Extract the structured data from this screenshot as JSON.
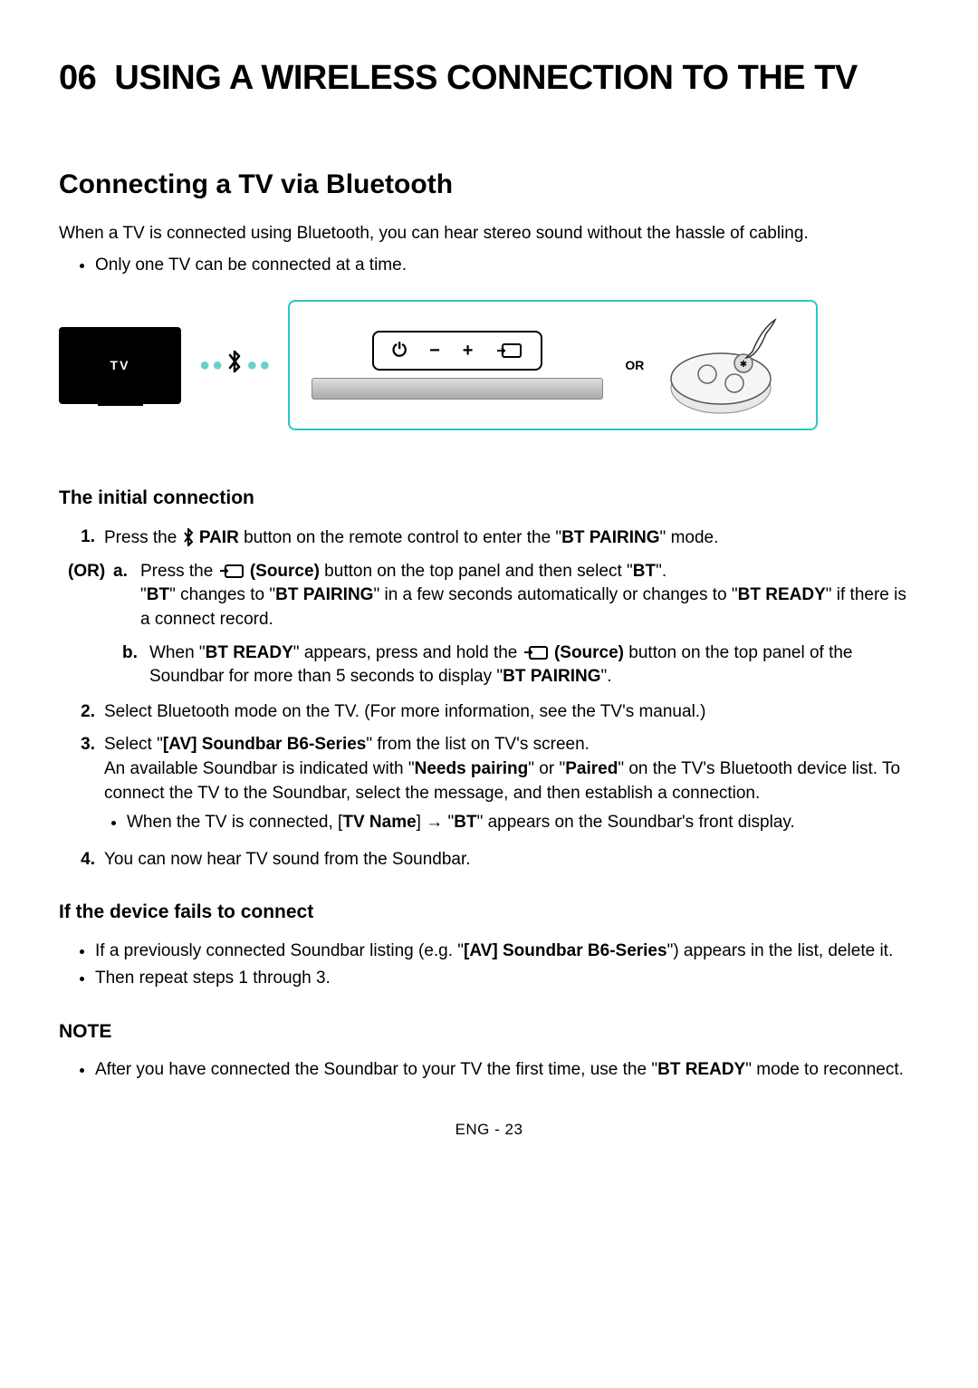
{
  "chapter": {
    "number": "06",
    "title": "USING A WIRELESS CONNECTION TO THE TV"
  },
  "section": {
    "heading": "Connecting a TV via Bluetooth",
    "intro": "When a TV is connected using Bluetooth, you can hear stereo sound without the hassle of cabling.",
    "bullet1": "Only one TV can be connected at a time."
  },
  "diagram": {
    "tv_label": "TV",
    "or_label": "OR",
    "panel": {
      "power": "⏻",
      "minus": "−",
      "plus": "+"
    }
  },
  "initial": {
    "heading": "The initial connection",
    "step1_prefix": "Press the ",
    "step1_pair": "PAIR",
    "step1_suffix": " button on the remote control to enter the \"",
    "step1_mode": "BT PAIRING",
    "step1_end": "\" mode.",
    "or_label": "(OR)",
    "a_prefix": "Press the ",
    "a_source": "(Source)",
    "a_mid": " button on the top panel and then select \"",
    "a_bt": "BT",
    "a_end": "\".",
    "a_line2_q1": "\"",
    "a_line2_bt": "BT",
    "a_line2_mid1": "\" changes to \"",
    "a_line2_pairing": "BT PAIRING",
    "a_line2_mid2": "\" in a few seconds automatically or changes to \"",
    "a_line2_ready": "BT READY",
    "a_line2_end": "\" if there is a connect record.",
    "b_prefix": "When \"",
    "b_ready": "BT READY",
    "b_mid1": "\" appears, press and hold the ",
    "b_source": "(Source)",
    "b_mid2": " button on the top panel of the Soundbar for more than 5 seconds to display \"",
    "b_pairing": "BT PAIRING",
    "b_end": "\".",
    "step2": "Select Bluetooth mode on the TV. (For more information, see the TV's manual.)",
    "step3_prefix": "Select \"",
    "step3_av": "[AV] Soundbar B6-Series",
    "step3_suffix": "\" from the list on TV's screen.",
    "step3_line2_pre": "An available Soundbar is indicated with \"",
    "step3_line2_needs": "Needs pairing",
    "step3_line2_mid": "\" or \"",
    "step3_line2_paired": "Paired",
    "step3_line2_end": "\" on the TV's Bluetooth device list. To connect the TV to the Soundbar, select the message, and then establish a connection.",
    "step3_sub_pre": "When the TV is connected, [",
    "step3_sub_tvname": "TV Name",
    "step3_sub_mid": "] → \"",
    "step3_sub_bt": "BT",
    "step3_sub_end": "\" appears on the Soundbar's front display.",
    "step4": "You can now hear TV sound from the Soundbar."
  },
  "fails": {
    "heading": "If the device fails to connect",
    "b1_pre": "If a previously connected Soundbar listing (e.g. \"",
    "b1_av": "[AV] Soundbar B6-Series",
    "b1_end": "\") appears in the list, delete it.",
    "b2": "Then repeat steps 1 through 3."
  },
  "note": {
    "heading": "NOTE",
    "b1_pre": "After you have connected the Soundbar to your TV the first time, use the \"",
    "b1_ready": "BT READY",
    "b1_end": "\" mode to reconnect."
  },
  "footer": "ENG - 23"
}
